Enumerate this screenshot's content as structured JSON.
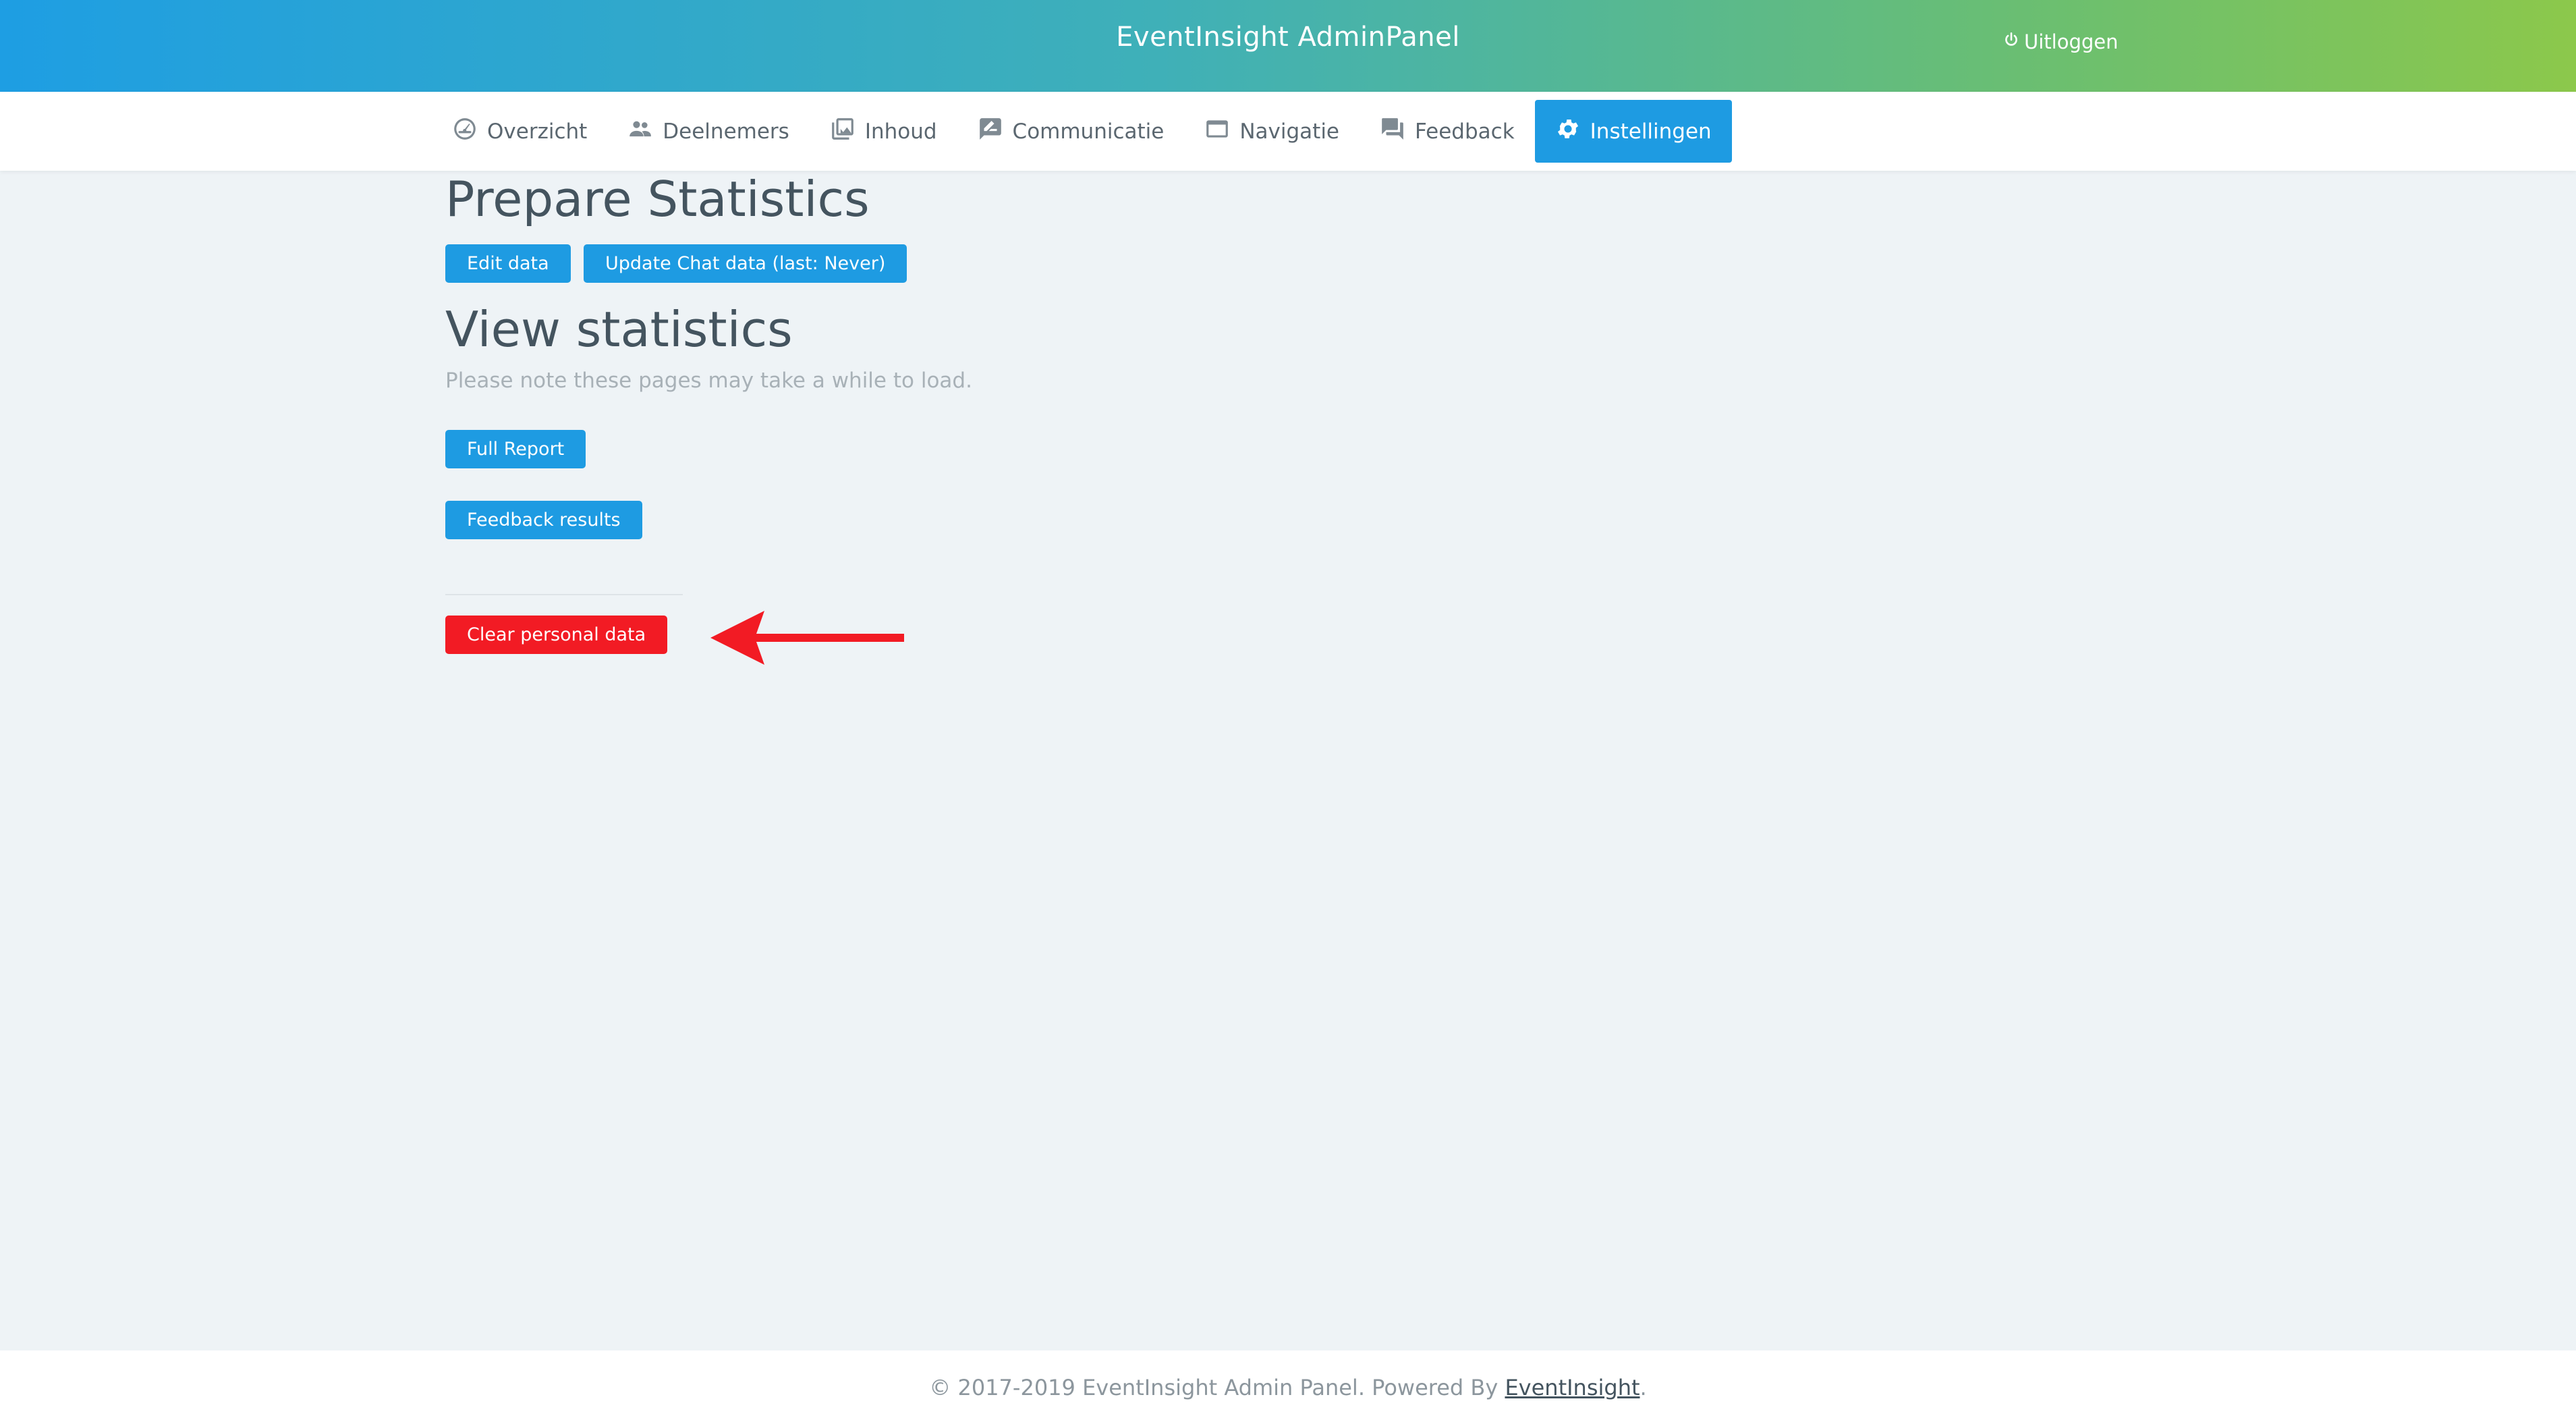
{
  "header": {
    "title": "EventInsight AdminPanel",
    "logout_label": "Uitloggen",
    "logout_icon": "power-icon",
    "gradient": [
      "#1e9ee3",
      "#8cc84b"
    ]
  },
  "nav": {
    "items": [
      {
        "label": "Overzicht",
        "icon": "dashboard-icon",
        "active": false
      },
      {
        "label": "Deelnemers",
        "icon": "people-icon",
        "active": false
      },
      {
        "label": "Inhoud",
        "icon": "library-icon",
        "active": false
      },
      {
        "label": "Communicatie",
        "icon": "message-icon",
        "active": false
      },
      {
        "label": "Navigatie",
        "icon": "window-icon",
        "active": false
      },
      {
        "label": "Feedback",
        "icon": "forum-icon",
        "active": false
      },
      {
        "label": "Instellingen",
        "icon": "gear-icon",
        "active": true
      }
    ],
    "active_color": "#1e9be2"
  },
  "main": {
    "prepare_title": "Prepare Statistics",
    "edit_data_label": "Edit data",
    "update_chat_label": "Update Chat data (last: Never)",
    "view_title": "View statistics",
    "note": "Please note these pages may take a while to load.",
    "full_report_label": "Full Report",
    "feedback_results_label": "Feedback results",
    "clear_personal_label": "Clear personal data",
    "danger_color": "#f21b24",
    "arrow_color": "#f21b24"
  },
  "footer": {
    "text": "© 2017-2019 EventInsight Admin Panel. Powered By ",
    "link": "EventInsight",
    "end": "."
  }
}
